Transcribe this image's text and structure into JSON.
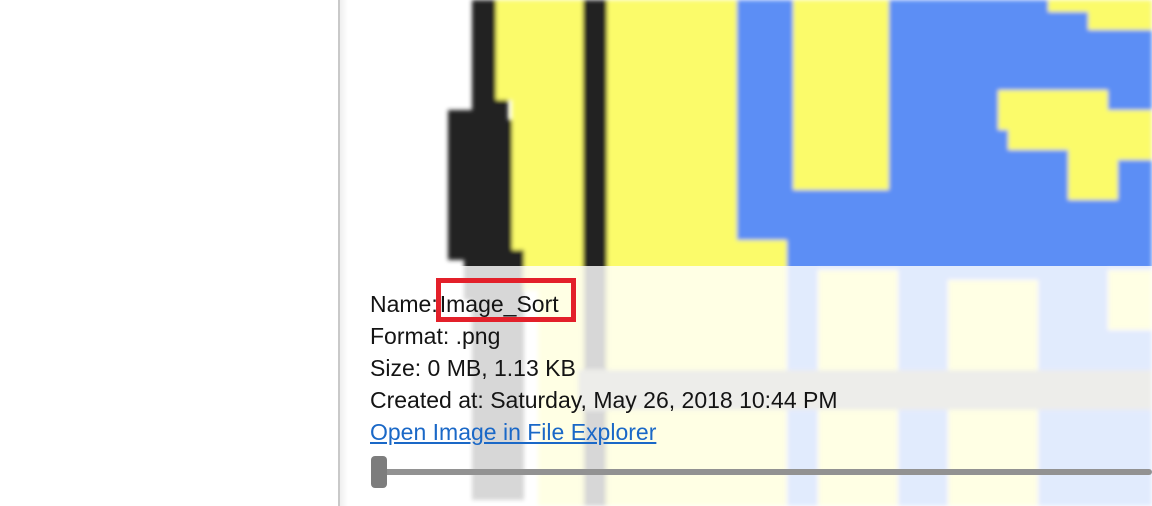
{
  "details": {
    "name_label": "Name:",
    "name_value": "Image_Sort",
    "format_label": "Format:",
    "format_value": ".png",
    "size_label": "Size:",
    "size_value": "0 MB, 1.13 KB",
    "created_label": "Created at:",
    "created_value": "Saturday, May 26, 2018 10:44 PM",
    "open_link": "Open Image in File Explorer"
  },
  "zoom_slider": {
    "value_fraction": 0.0
  },
  "colors": {
    "highlight": "#e3202a",
    "link": "#1a68c7",
    "preview_yellow": "#fbfb6b",
    "preview_blue": "#5b8ef5",
    "preview_outline": "#202020"
  },
  "icons": {
    "preview": "pixel-art-image-preview"
  }
}
